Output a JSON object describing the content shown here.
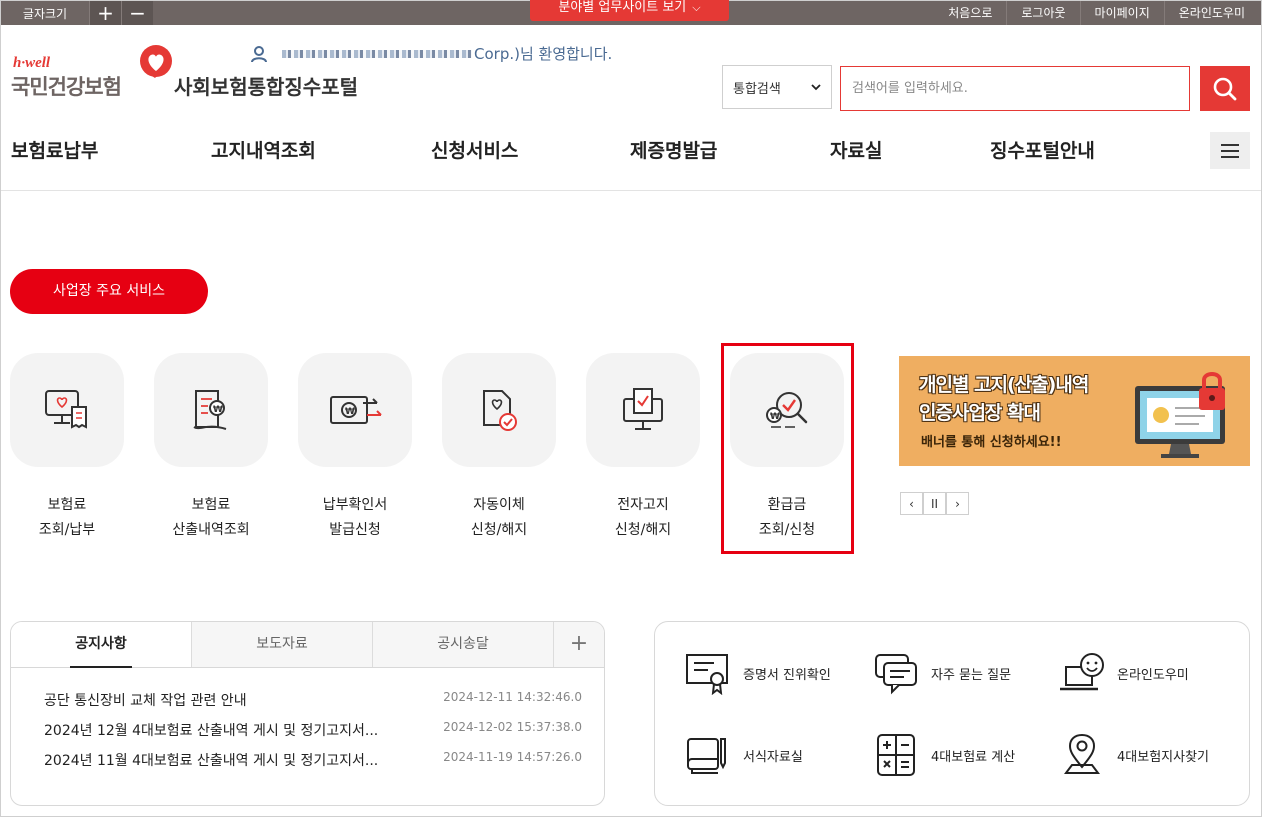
{
  "topbar": {
    "font_size_label": "글자크기",
    "plus": "+",
    "minus": "−",
    "site_button": "분야별 업무사이트 보기",
    "site_button_chevron": "⌵",
    "links": [
      "처음으로",
      "로그아웃",
      "마이페이지",
      "온라인도우미"
    ]
  },
  "header": {
    "logo_hwell": "h·well",
    "logo_org": "국민건강보험",
    "portal_title": "사회보험통합징수포털",
    "welcome_suffix": "Corp.)님 환영합니다."
  },
  "search": {
    "scope": "통합검색",
    "placeholder": "검색어를 입력하세요."
  },
  "gnb": [
    "보험료납부",
    "고지내역조회",
    "신청서비스",
    "제증명발급",
    "자료실",
    "징수포털안내"
  ],
  "services": {
    "title": "사업장 주요 서비스",
    "items": [
      {
        "line1": "보험료",
        "line2": "조회/납부"
      },
      {
        "line1": "보험료",
        "line2": "산출내역조회"
      },
      {
        "line1": "납부확인서",
        "line2": "발급신청"
      },
      {
        "line1": "자동이체",
        "line2": "신청/해지"
      },
      {
        "line1": "전자고지",
        "line2": "신청/해지"
      },
      {
        "line1": "환급금",
        "line2": "조회/신청"
      }
    ]
  },
  "banner": {
    "line1": "개인별 고지(산출)내역",
    "line2": "인증사업장 확대",
    "line3": "배너를 통해 신청하세요!!",
    "controls": [
      "‹",
      "II",
      "›"
    ]
  },
  "notices": {
    "tabs": [
      "공지사항",
      "보도자료",
      "공시송달"
    ],
    "more": "+",
    "items": [
      {
        "title": "공단 통신장비 교체 작업 관련 안내",
        "date": "2024-12-11 14:32:46.0"
      },
      {
        "title": "2024년 12월 4대보험료 산출내역 게시 및 정기고지서...",
        "date": "2024-12-02 15:37:38.0"
      },
      {
        "title": "2024년 11월 4대보험료 산출내역 게시 및 정기고지서...",
        "date": "2024-11-19 14:57:26.0"
      }
    ]
  },
  "quick_links": [
    "증명서 진위확인",
    "자주 묻는 질문",
    "온라인도우미",
    "서식자료실",
    "4대보험료 계산",
    "4대보험지사찾기"
  ],
  "colors": {
    "brand_red": "#e60012",
    "topbar": "#6e6563",
    "banner": "#efae61"
  }
}
